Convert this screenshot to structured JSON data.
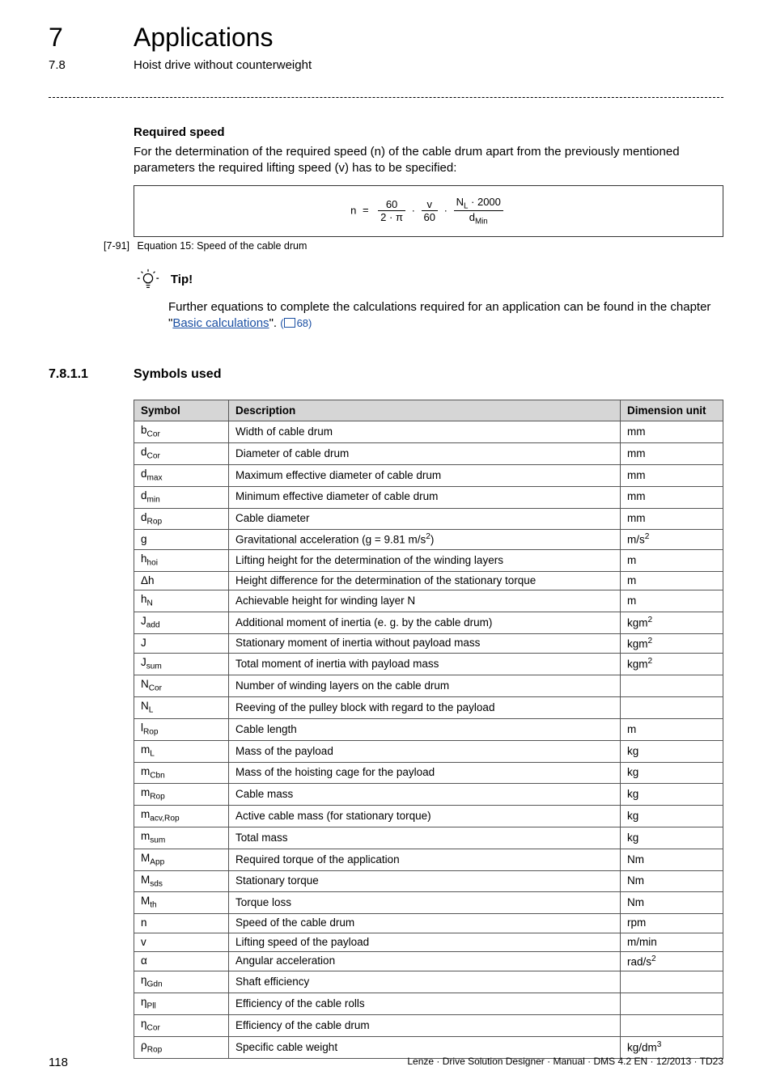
{
  "header": {
    "chapter_num": "7",
    "chapter_title": "Applications",
    "section_num": "7.8",
    "section_title": "Hoist drive without counterweight"
  },
  "required_speed": {
    "heading": "Required speed",
    "paragraph": "For the determination of the required speed (n) of the cable drum apart from the previously mentioned parameters the required lifting speed (v) has to be specified:",
    "equation": {
      "lhs": "n",
      "eq": "=",
      "frac1_num": "60",
      "frac1_den": "2 · π",
      "dot1": "·",
      "frac2_num": "v",
      "frac2_den": "60",
      "dot2": "·",
      "frac3_num_left": "N",
      "frac3_num_sub": "L",
      "frac3_num_right": " · 2000",
      "frac3_den_left": "d",
      "frac3_den_sub": "Min"
    },
    "caption_label": "[7-91]",
    "caption_text": "Equation 15: Speed of the cable drum"
  },
  "tip": {
    "label": "Tip!",
    "body_pre": "Further equations to complete the calculations required for an application can be found in the chapter \"",
    "link_text": "Basic calculations",
    "body_post": "\". ",
    "page_ref": "68)"
  },
  "subsection": {
    "num": "7.8.1.1",
    "title": "Symbols used"
  },
  "table": {
    "headers": {
      "symbol": "Symbol",
      "description": "Description",
      "unit": "Dimension unit"
    },
    "rows": [
      {
        "sym": "b",
        "sub": "Cor",
        "desc": "Width of cable drum",
        "unit": "mm"
      },
      {
        "sym": "d",
        "sub": "Cor",
        "desc": "Diameter of cable drum",
        "unit": "mm"
      },
      {
        "sym": "d",
        "sub": "max",
        "desc": "Maximum effective diameter of cable drum",
        "unit": "mm"
      },
      {
        "sym": "d",
        "sub": "min",
        "desc": "Minimum effective diameter of cable drum",
        "unit": "mm"
      },
      {
        "sym": "d",
        "sub": "Rop",
        "desc": "Cable diameter",
        "unit": "mm"
      },
      {
        "sym": "g",
        "sub": "",
        "desc": "Gravitational acceleration (g = 9.81 m/s",
        "desc_sup": "2",
        "desc_post": ")",
        "unit": "m/s",
        "unit_sup": "2"
      },
      {
        "sym": "h",
        "sub": "hoi",
        "desc": "Lifting height for the determination of the winding layers",
        "unit": "m"
      },
      {
        "sym": "Δh",
        "sub": "",
        "desc": "Height difference for the determination of the stationary torque",
        "unit": "m"
      },
      {
        "sym": "h",
        "sub": "N",
        "desc": "Achievable height for winding layer N",
        "unit": "m"
      },
      {
        "sym": "J",
        "sub": "add",
        "desc": "Additional moment of inertia (e. g. by the cable drum)",
        "unit": "kgm",
        "unit_sup": "2"
      },
      {
        "sym": "J",
        "sub": "",
        "desc": "Stationary moment of inertia without payload mass",
        "unit": "kgm",
        "unit_sup": "2"
      },
      {
        "sym": "J",
        "sub": "sum",
        "desc": "Total moment of inertia with payload mass",
        "unit": "kgm",
        "unit_sup": "2"
      },
      {
        "sym": "N",
        "sub": "Cor",
        "desc": "Number of winding layers on the cable drum",
        "unit": ""
      },
      {
        "sym": "N",
        "sub": "L",
        "desc": "Reeving of the pulley block with regard to the payload",
        "unit": ""
      },
      {
        "sym": "l",
        "sub": "Rop",
        "desc": "Cable length",
        "unit": "m"
      },
      {
        "sym": "m",
        "sub": "L",
        "desc": "Mass of the payload",
        "unit": "kg"
      },
      {
        "sym": "m",
        "sub": "Cbn",
        "desc": "Mass of the hoisting cage for the payload",
        "unit": "kg"
      },
      {
        "sym": "m",
        "sub": "Rop",
        "desc": "Cable mass",
        "unit": "kg"
      },
      {
        "sym": "m",
        "sub": "acv,Rop",
        "desc": "Active cable mass (for stationary torque)",
        "unit": "kg"
      },
      {
        "sym": "m",
        "sub": "sum",
        "desc": "Total mass",
        "unit": "kg"
      },
      {
        "sym": "M",
        "sub": "App",
        "desc": "Required torque of the application",
        "unit": "Nm"
      },
      {
        "sym": "M",
        "sub": "sds",
        "desc": "Stationary torque",
        "unit": "Nm"
      },
      {
        "sym": "M",
        "sub": "th",
        "desc": "Torque loss",
        "unit": "Nm"
      },
      {
        "sym": "n",
        "sub": "",
        "desc": "Speed of the cable drum",
        "unit": "rpm"
      },
      {
        "sym": "v",
        "sub": "",
        "desc": "Lifting speed of the payload",
        "unit": "m/min"
      },
      {
        "sym": "α",
        "sub": "",
        "desc": "Angular acceleration",
        "unit": "rad/s",
        "unit_sup": "2"
      },
      {
        "sym": "η",
        "sub": "Gdn",
        "desc": "Shaft efficiency",
        "unit": ""
      },
      {
        "sym": "η",
        "sub": "Pll",
        "desc": "Efficiency of the cable rolls",
        "unit": ""
      },
      {
        "sym": "η",
        "sub": "Cor",
        "desc": "Efficiency of the cable drum",
        "unit": ""
      },
      {
        "sym": "ρ",
        "sub": "Rop",
        "desc": "Specific cable weight",
        "unit": "kg/dm",
        "unit_sup": "3"
      }
    ]
  },
  "footer": {
    "page": "118",
    "text": "Lenze · Drive Solution Designer · Manual · DMS 4.2 EN · 12/2013 · TD23"
  }
}
